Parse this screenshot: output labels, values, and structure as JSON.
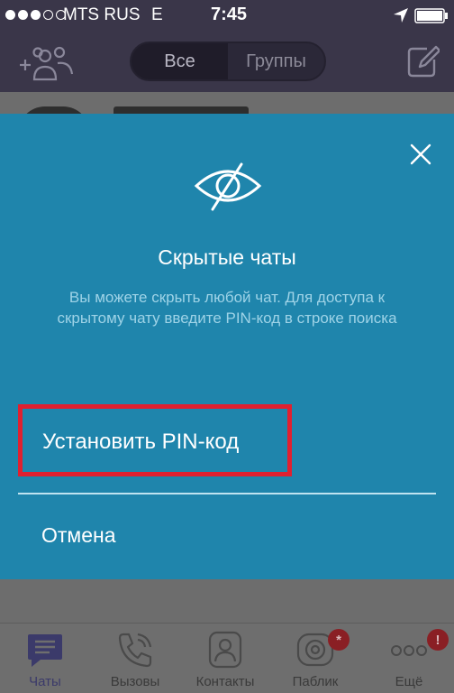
{
  "status_bar": {
    "carrier": "MTS RUS",
    "network": "E",
    "time": "7:45",
    "signal_bars_filled": 3,
    "signal_bars_total": 5,
    "location_icon": "location-arrow-icon",
    "battery_icon": "battery-full-icon"
  },
  "header": {
    "add_group_icon": "add-group-icon",
    "segments": [
      {
        "label": "Все",
        "active": true
      },
      {
        "label": "Группы",
        "active": false
      }
    ],
    "compose_icon": "compose-icon"
  },
  "modal": {
    "close_icon": "close-icon",
    "hidden_icon": "eye-slash-icon",
    "title": "Скрытые чаты",
    "description": "Вы можете скрыть любой чат. Для доступа к скрытому чату введите PIN-код в строке поиска",
    "primary_action": "Установить PIN-код",
    "cancel_action": "Отмена"
  },
  "tabbar": {
    "tabs": [
      {
        "label": "Чаты",
        "icon": "chat-bubble-icon",
        "active": true
      },
      {
        "label": "Вызовы",
        "icon": "phone-icon",
        "active": false
      },
      {
        "label": "Контакты",
        "icon": "contact-icon",
        "active": false
      },
      {
        "label": "Паблик",
        "icon": "public-chats-icon",
        "active": false,
        "badge": "*"
      },
      {
        "label": "Ещё",
        "icon": "more-dots-icon",
        "active": false,
        "badge": "!"
      }
    ]
  },
  "colors": {
    "header_bg": "#3a3649",
    "modal_bg": "#1f85ac",
    "highlight_border": "#e02030",
    "overlay_bg": "#6d6d6d"
  }
}
